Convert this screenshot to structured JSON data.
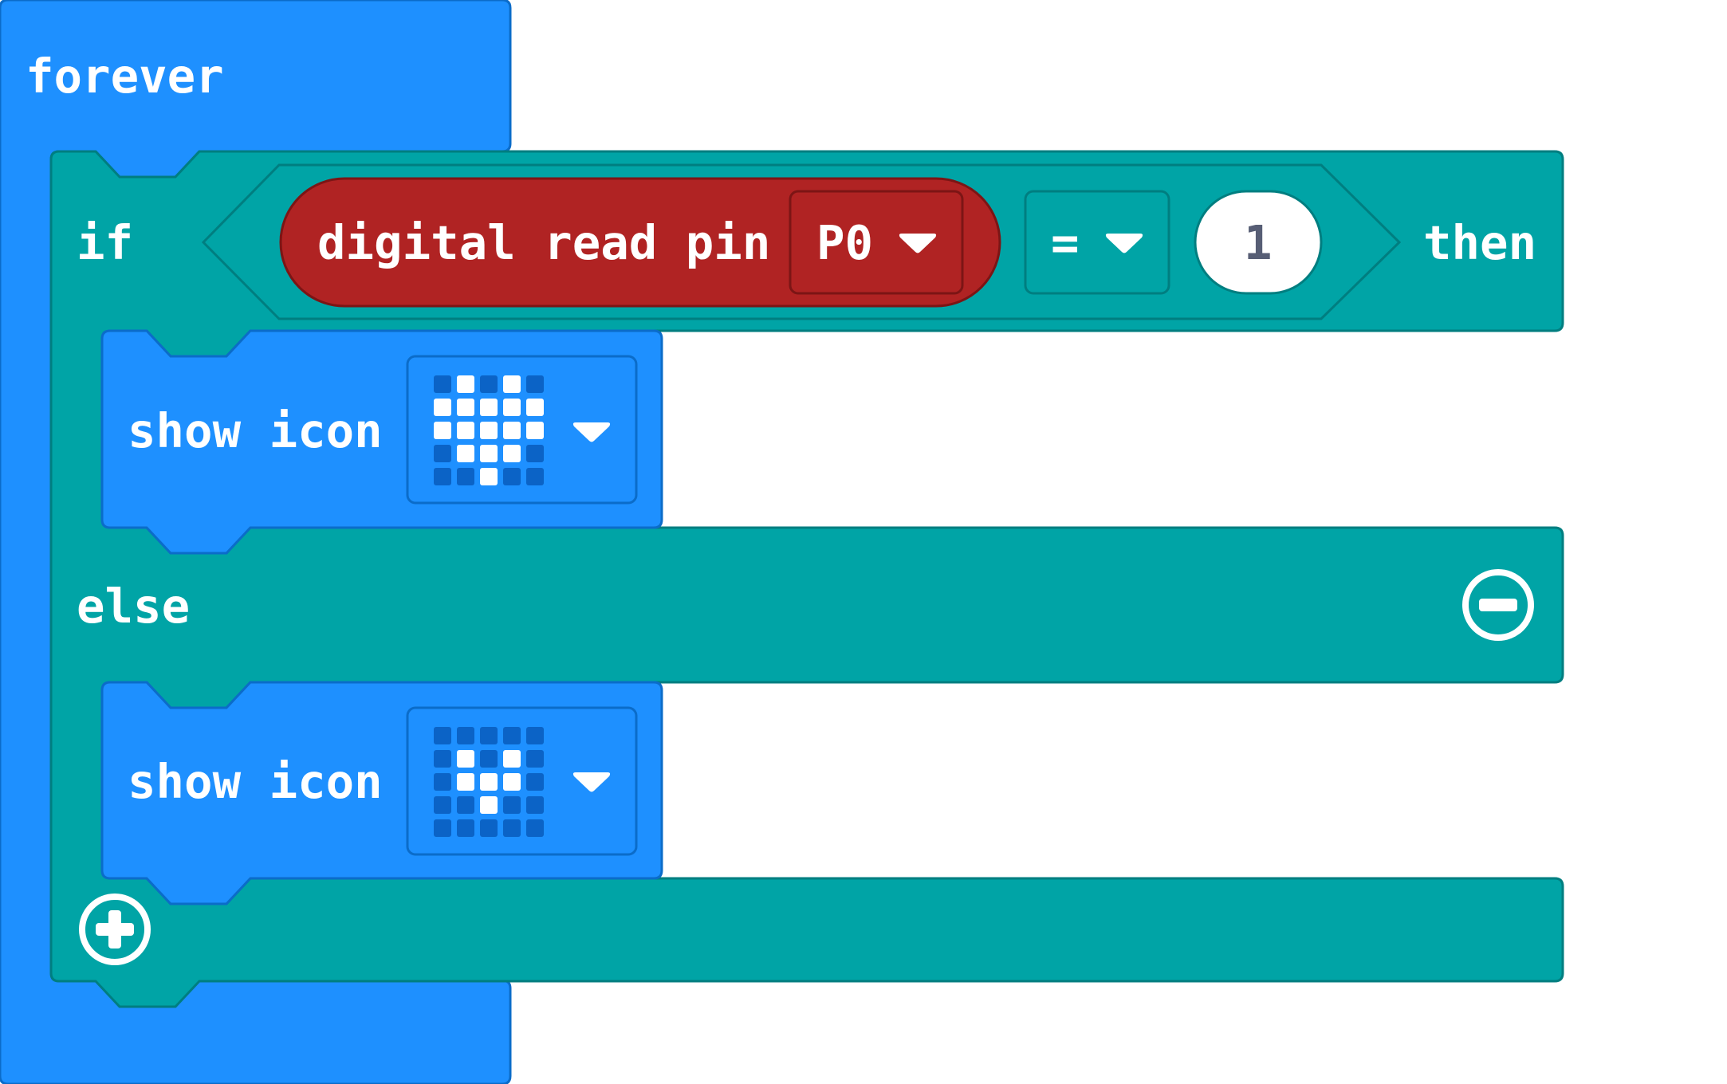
{
  "colors": {
    "loop_block": "#1e90ff",
    "loop_border": "#0b6cc9",
    "logic_block": "#00a4a6",
    "logic_border": "#007e80",
    "pin_block": "#b02323",
    "pin_border": "#7c1515",
    "led_on": "#ffffff",
    "led_off": "#0b63c6",
    "number_text": "#575e75"
  },
  "forever_block": {
    "label": "forever"
  },
  "if_block": {
    "if_label": "if",
    "then_label": "then",
    "else_label": "else",
    "condition": {
      "read_label": "digital read pin",
      "pin_value": "P0",
      "operator": "=",
      "compare_value": "1"
    },
    "remove_else_icon": "minus-circle-icon",
    "add_branch_icon": "plus-circle-icon"
  },
  "then_branch": {
    "label": "show icon",
    "icon_name": "heart",
    "led_grid": [
      [
        0,
        1,
        0,
        1,
        0
      ],
      [
        1,
        1,
        1,
        1,
        1
      ],
      [
        1,
        1,
        1,
        1,
        1
      ],
      [
        0,
        1,
        1,
        1,
        0
      ],
      [
        0,
        0,
        1,
        0,
        0
      ]
    ]
  },
  "else_branch": {
    "label": "show icon",
    "icon_name": "small-heart",
    "led_grid": [
      [
        0,
        0,
        0,
        0,
        0
      ],
      [
        0,
        1,
        0,
        1,
        0
      ],
      [
        0,
        1,
        1,
        1,
        0
      ],
      [
        0,
        0,
        1,
        0,
        0
      ],
      [
        0,
        0,
        0,
        0,
        0
      ]
    ]
  }
}
